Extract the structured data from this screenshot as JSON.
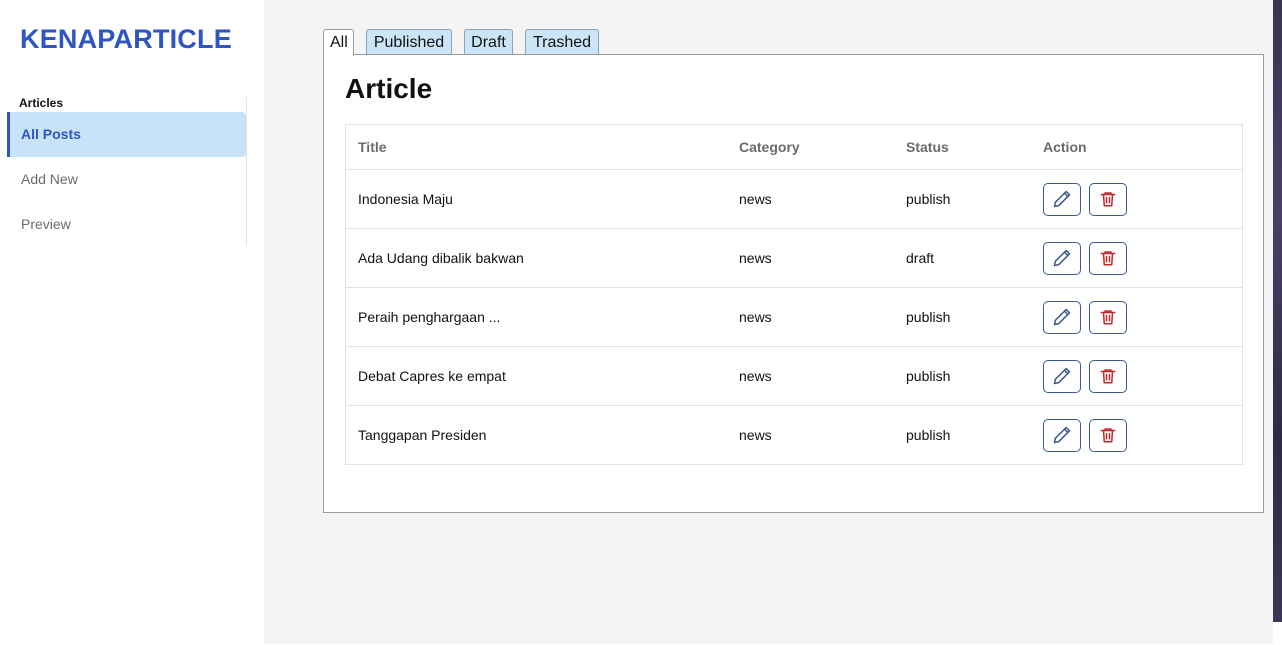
{
  "brand": "KENAPARTICLE",
  "sidebar": {
    "section_label": "Articles",
    "items": [
      {
        "label": "All Posts",
        "active": true
      },
      {
        "label": "Add New",
        "active": false
      },
      {
        "label": "Preview",
        "active": false
      }
    ]
  },
  "tabs": [
    {
      "label": "All",
      "active": true
    },
    {
      "label": "Published",
      "active": false
    },
    {
      "label": "Draft",
      "active": false
    },
    {
      "label": "Trashed",
      "active": false
    }
  ],
  "main": {
    "title": "Article",
    "columns": [
      "Title",
      "Category",
      "Status",
      "Action"
    ],
    "rows": [
      {
        "title": "Indonesia Maju",
        "category": "news",
        "status": "publish"
      },
      {
        "title": "Ada Udang dibalik bakwan",
        "category": "news",
        "status": "draft"
      },
      {
        "title": "Peraih penghargaan ...",
        "category": "news",
        "status": "publish"
      },
      {
        "title": "Debat Capres ke empat",
        "category": "news",
        "status": "publish"
      },
      {
        "title": "Tanggapan Presiden",
        "category": "news",
        "status": "publish"
      }
    ],
    "actions": {
      "edit_icon": "pencil-icon",
      "delete_icon": "trash-icon"
    }
  },
  "colors": {
    "accent": "#2f55c2",
    "active_bg": "#c8e3f7",
    "tab_bg": "#cbe4f6",
    "edit_icon": "#3b5a8c",
    "delete_icon": "#c0282d"
  }
}
